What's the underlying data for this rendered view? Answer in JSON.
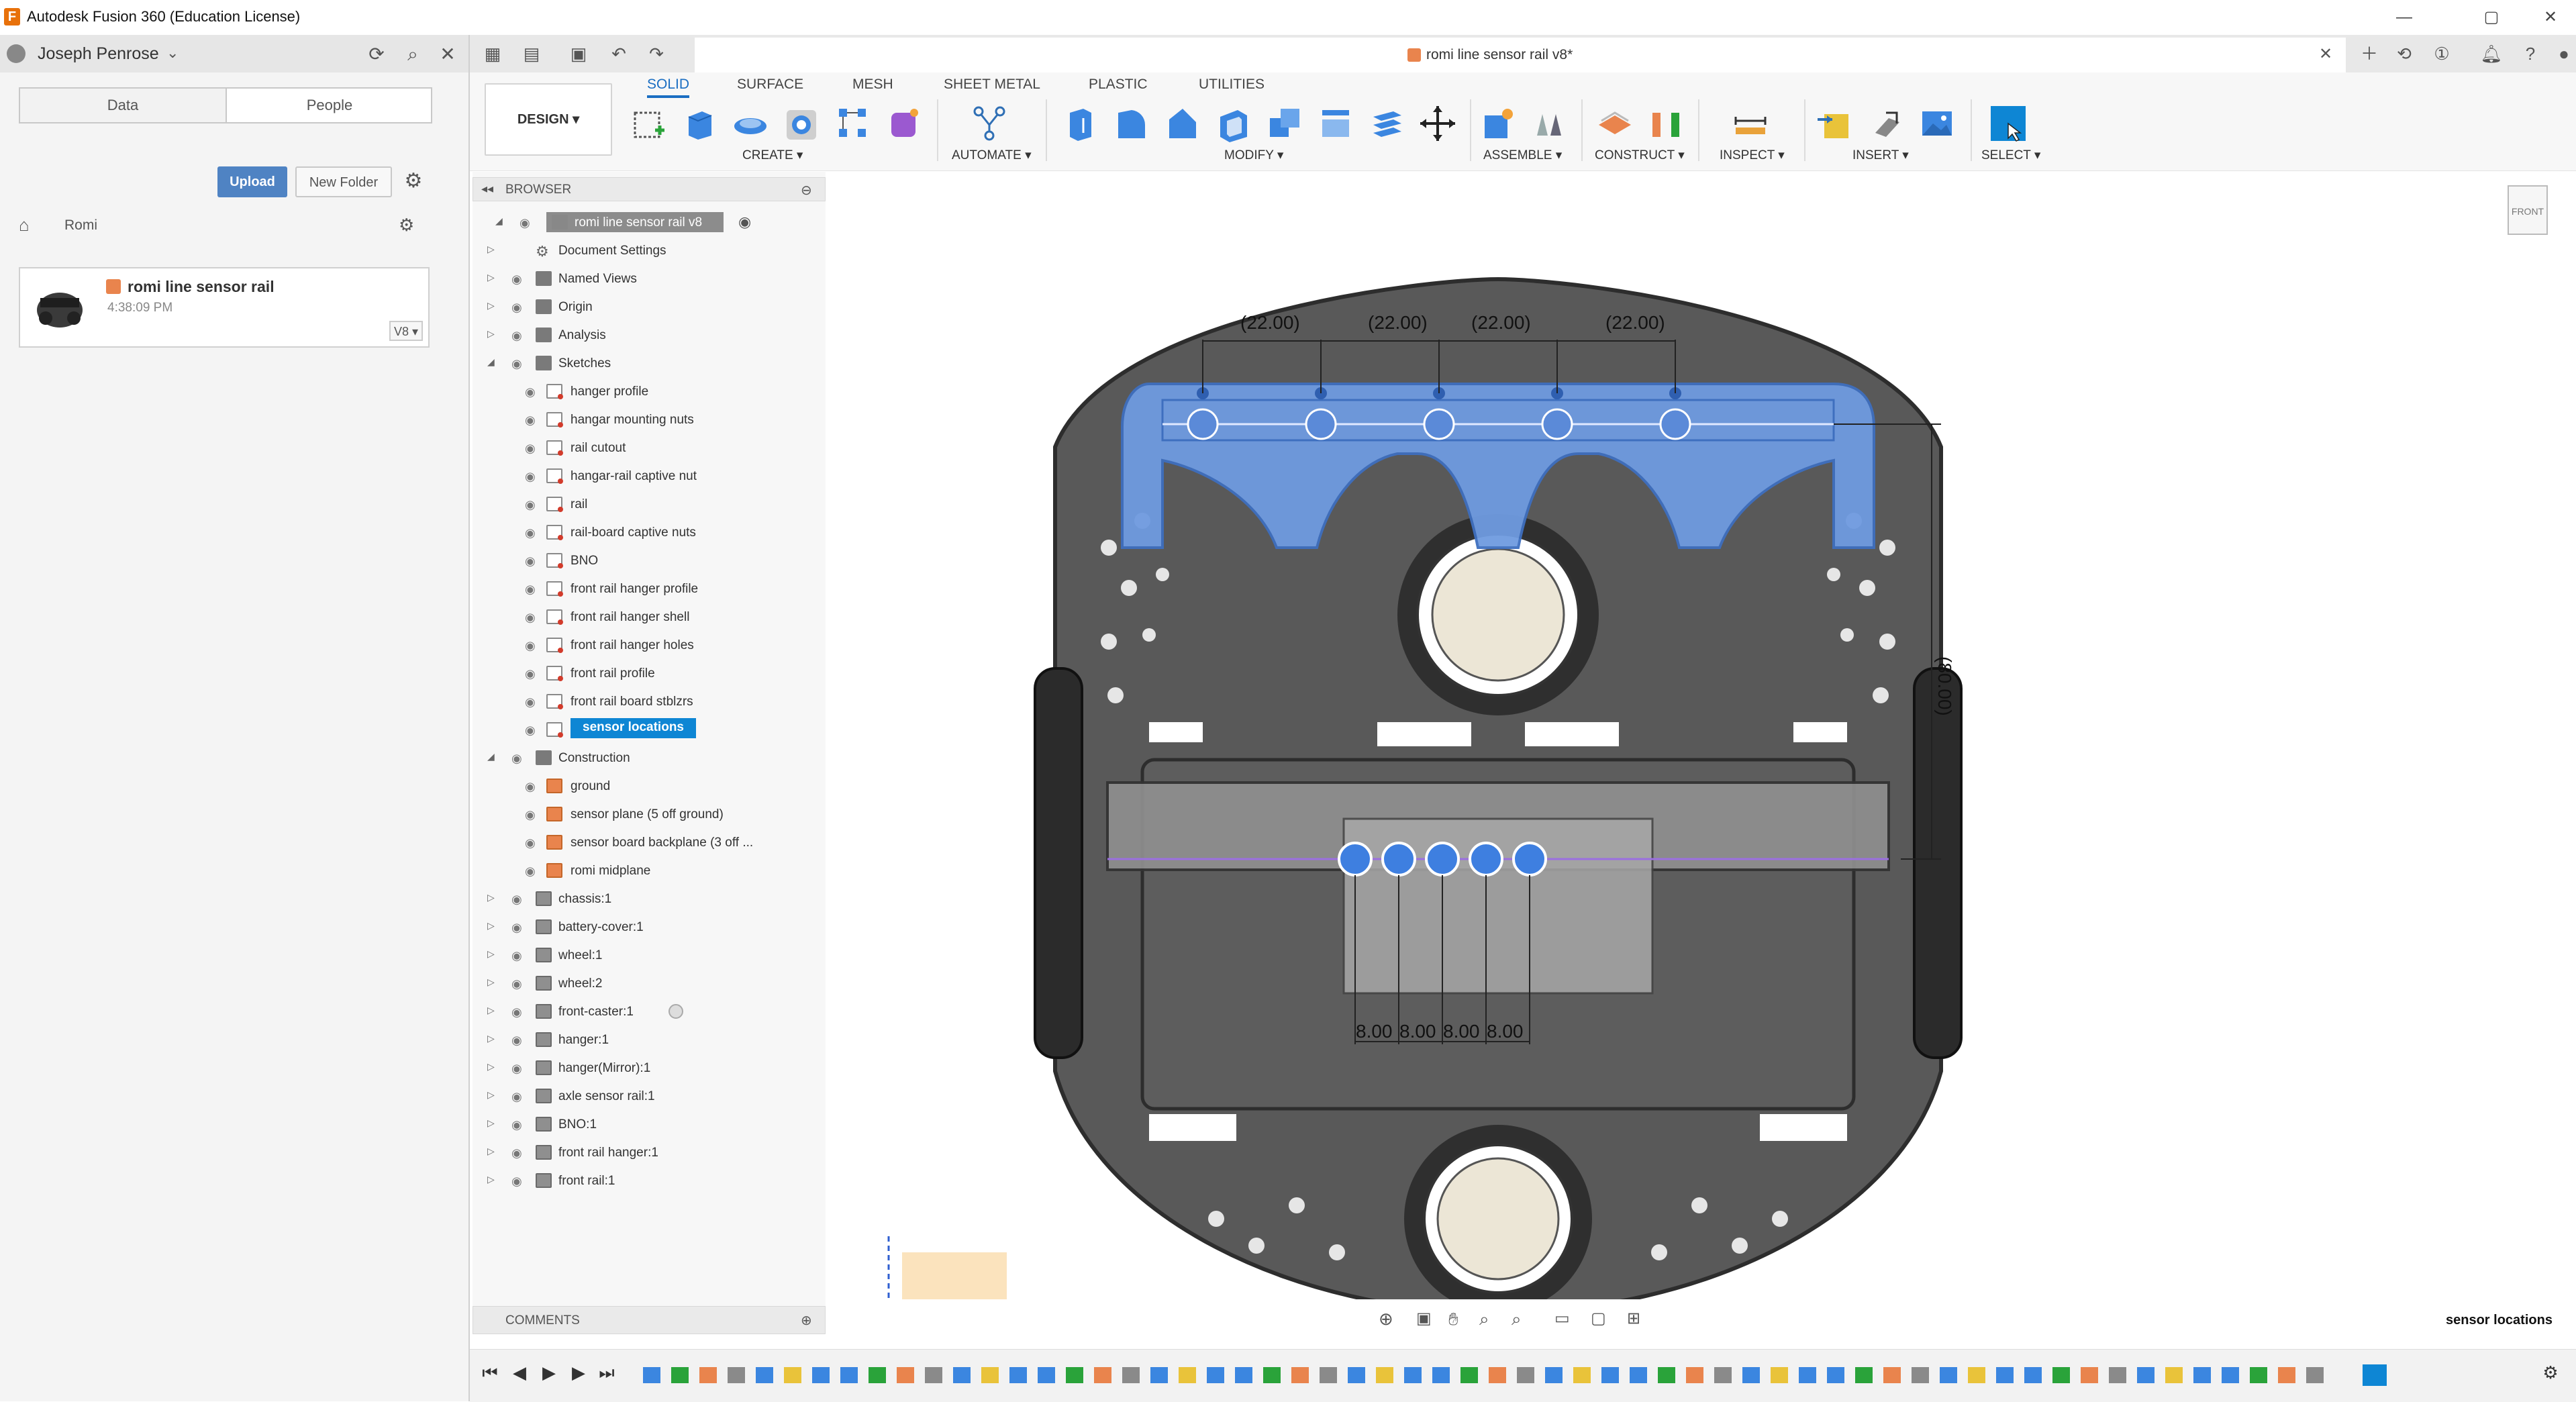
{
  "window": {
    "title": "Autodesk Fusion 360 (Education License)",
    "app_icon": "F"
  },
  "data_panel": {
    "user_name": "Joseph Penrose",
    "tabs": [
      "Data",
      "People"
    ],
    "upload_label": "Upload",
    "new_folder_label": "New Folder",
    "breadcrumb": "Romi",
    "file": {
      "name": "romi line sensor rail",
      "time": "4:38:09 PM",
      "version": "V8 ▾"
    }
  },
  "document": {
    "tab_title": "romi line sensor rail v8*"
  },
  "ribbon": {
    "design_label": "DESIGN ▾",
    "tabs": [
      "SOLID",
      "SURFACE",
      "MESH",
      "SHEET METAL",
      "PLASTIC",
      "UTILITIES"
    ],
    "active_tab": "SOLID",
    "groups": [
      "CREATE ▾",
      "AUTOMATE ▾",
      "MODIFY ▾",
      "ASSEMBLE ▾",
      "CONSTRUCT ▾",
      "INSPECT ▾",
      "INSERT ▾",
      "SELECT ▾"
    ]
  },
  "browser": {
    "title": "BROWSER",
    "root": "romi line sensor rail v8",
    "items": [
      {
        "label": "Document Settings",
        "icon": "gear"
      },
      {
        "label": "Named Views",
        "icon": "folder"
      },
      {
        "label": "Origin",
        "icon": "folder"
      },
      {
        "label": "Analysis",
        "icon": "folder"
      },
      {
        "label": "Sketches",
        "icon": "folder"
      },
      {
        "label": "hanger profile",
        "icon": "sketch"
      },
      {
        "label": "hangar mounting nuts",
        "icon": "sketch"
      },
      {
        "label": "rail cutout",
        "icon": "sketch"
      },
      {
        "label": "hangar-rail captive nut",
        "icon": "sketch"
      },
      {
        "label": "rail",
        "icon": "sketch"
      },
      {
        "label": "rail-board captive nuts",
        "icon": "sketch"
      },
      {
        "label": "BNO",
        "icon": "sketch"
      },
      {
        "label": "front rail hanger profile",
        "icon": "sketch"
      },
      {
        "label": "front rail hanger shell",
        "icon": "sketch"
      },
      {
        "label": "front rail hanger holes",
        "icon": "sketch"
      },
      {
        "label": "front rail profile",
        "icon": "sketch"
      },
      {
        "label": "front rail board stblzrs",
        "icon": "sketch"
      },
      {
        "label": "sensor locations",
        "icon": "sketch"
      },
      {
        "label": "Construction",
        "icon": "folder"
      },
      {
        "label": "ground",
        "icon": "plane"
      },
      {
        "label": "sensor plane (5 off ground)",
        "icon": "plane"
      },
      {
        "label": "sensor board backplane (3 off ...",
        "icon": "plane"
      },
      {
        "label": "romi midplane",
        "icon": "plane"
      },
      {
        "label": "chassis:1",
        "icon": "component"
      },
      {
        "label": "battery-cover:1",
        "icon": "component"
      },
      {
        "label": "wheel:1",
        "icon": "component"
      },
      {
        "label": "wheel:2",
        "icon": "component"
      },
      {
        "label": "front-caster:1",
        "icon": "component"
      },
      {
        "label": "hanger:1",
        "icon": "component"
      },
      {
        "label": "hanger(Mirror):1",
        "icon": "component"
      },
      {
        "label": "axle sensor rail:1",
        "icon": "component"
      },
      {
        "label": "BNO:1",
        "icon": "component"
      },
      {
        "label": "front rail hanger:1",
        "icon": "component"
      },
      {
        "label": "front rail:1",
        "icon": "component"
      }
    ]
  },
  "comments": {
    "title": "COMMENTS"
  },
  "viewport": {
    "viewcube_label": "FRONT",
    "dimensions": {
      "top_spacing": [
        "(22.00)",
        "(22.00)",
        "(22.00)",
        "(22.00)"
      ],
      "vertical": "(80.00)",
      "sensor_spacing": [
        "8.00",
        "8.00",
        "8.00",
        "8.00"
      ]
    },
    "status_label": "sensor locations"
  },
  "colors": {
    "accent": "#1b6ec2",
    "selection": "#0e86d4",
    "hanger_blue": "#6f9be0",
    "chassis": "#5a5a5a",
    "sensor_circle": "#3e7fe0"
  }
}
